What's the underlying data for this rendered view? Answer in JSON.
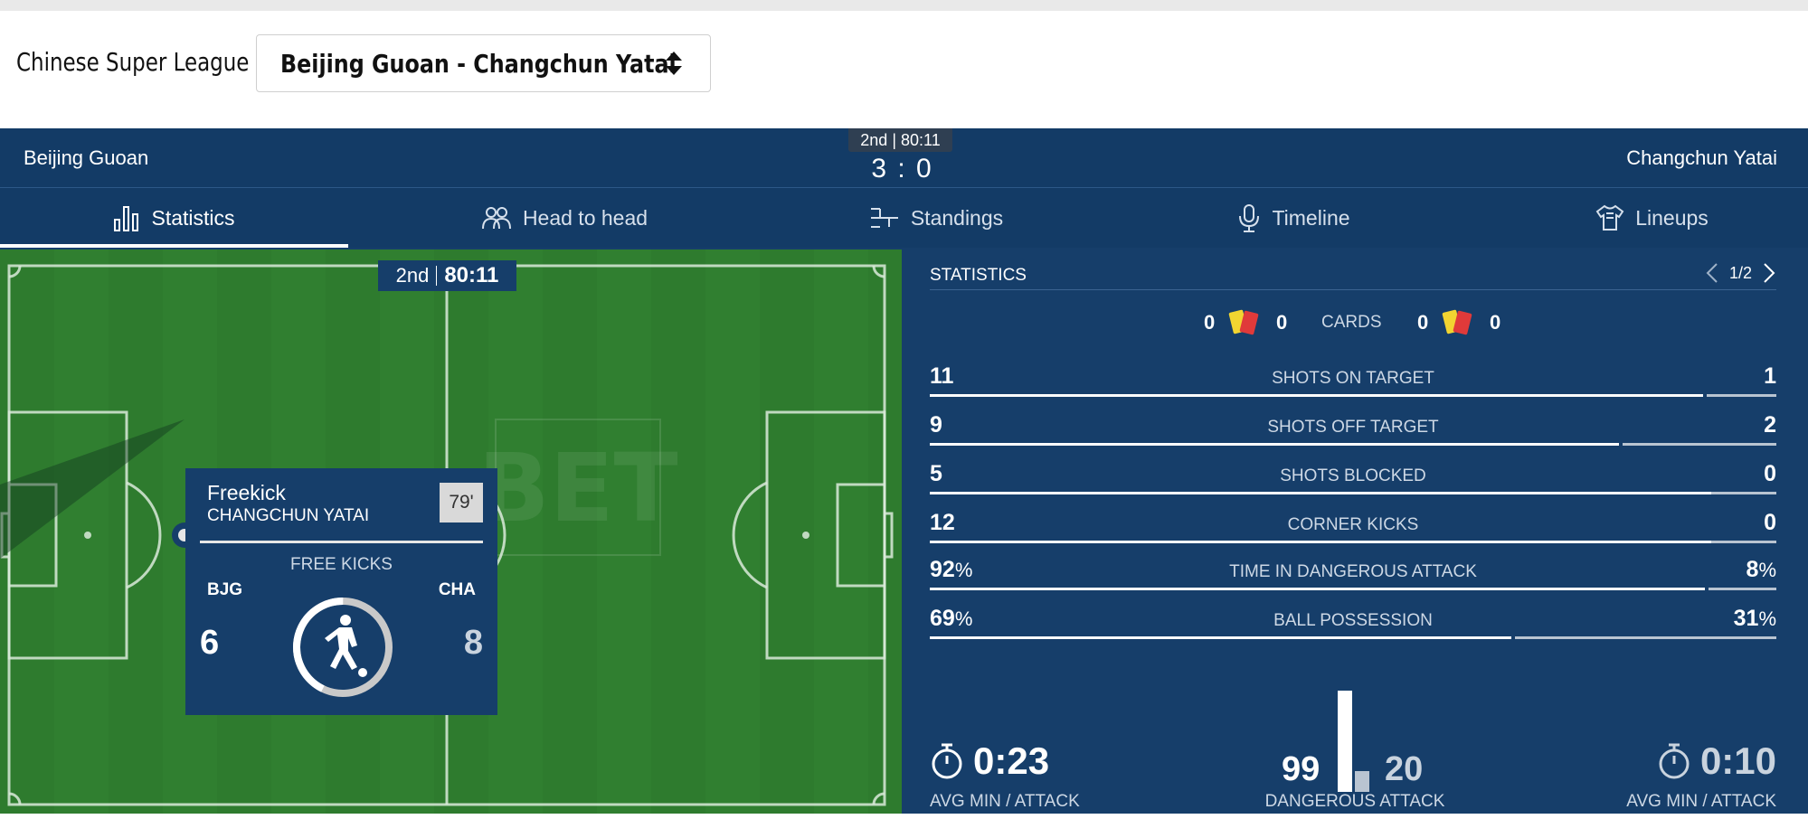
{
  "selector": {
    "league_label": "Chinese Super League -",
    "match_value": "Beijing Guoan - Changchun Yatai"
  },
  "scoreboard": {
    "home_team": "Beijing Guoan",
    "away_team": "Changchun Yatai",
    "period_time": "2nd | 80:11",
    "score": "3 : 0"
  },
  "tabs": [
    {
      "label": "Statistics",
      "icon": "bar-chart-icon",
      "active": true
    },
    {
      "label": "Head to head",
      "icon": "people-icon",
      "active": false
    },
    {
      "label": "Standings",
      "icon": "standings-icon",
      "active": false
    },
    {
      "label": "Timeline",
      "icon": "microphone-icon",
      "active": false
    },
    {
      "label": "Lineups",
      "icon": "jersey-icon",
      "active": false
    }
  ],
  "pitch": {
    "period": "2nd",
    "clock": "80:11",
    "watermark": "BET",
    "event": {
      "title": "Freekick",
      "team": "CHANGCHUN YATAI",
      "minute": "79'",
      "stat_label": "FREE KICKS",
      "home_abbr": "BJG",
      "away_abbr": "CHA",
      "home_value": "6",
      "away_value": "8",
      "home_share": 0.4286
    }
  },
  "statistics": {
    "title": "STATISTICS",
    "page": "1/2",
    "cards": {
      "label": "CARDS",
      "home_yellow": "0",
      "home_red": "0",
      "away_yellow": "0",
      "away_red": "0"
    },
    "rows": [
      {
        "label": "SHOTS ON TARGET",
        "home": "11",
        "away": "1",
        "home_share": 0.917
      },
      {
        "label": "SHOTS OFF TARGET",
        "home": "9",
        "away": "2",
        "home_share": 0.818
      },
      {
        "label": "SHOTS BLOCKED",
        "home": "5",
        "away": "0",
        "home_share": 1.0
      },
      {
        "label": "CORNER KICKS",
        "home": "12",
        "away": "0",
        "home_share": 1.0
      },
      {
        "label": "TIME IN DANGEROUS ATTACK",
        "home": "92",
        "away": "8",
        "unit": "%",
        "home_share": 0.92
      },
      {
        "label": "BALL POSSESSION",
        "home": "69",
        "away": "31",
        "unit": "%",
        "home_share": 0.69
      }
    ],
    "bottom": {
      "home_avg": "0:23",
      "home_avg_label": "AVG MIN / ATTACK",
      "dangerous_home": "99",
      "dangerous_away": "20",
      "dangerous_label": "DANGEROUS ATTACK",
      "away_avg": "0:10",
      "away_avg_label": "AVG MIN / ATTACK"
    }
  },
  "colors": {
    "widget_bg": "#163e6a",
    "pitch_green": "#2f7d2f",
    "yellow_card": "#f2d531",
    "red_card": "#e03a3a"
  }
}
